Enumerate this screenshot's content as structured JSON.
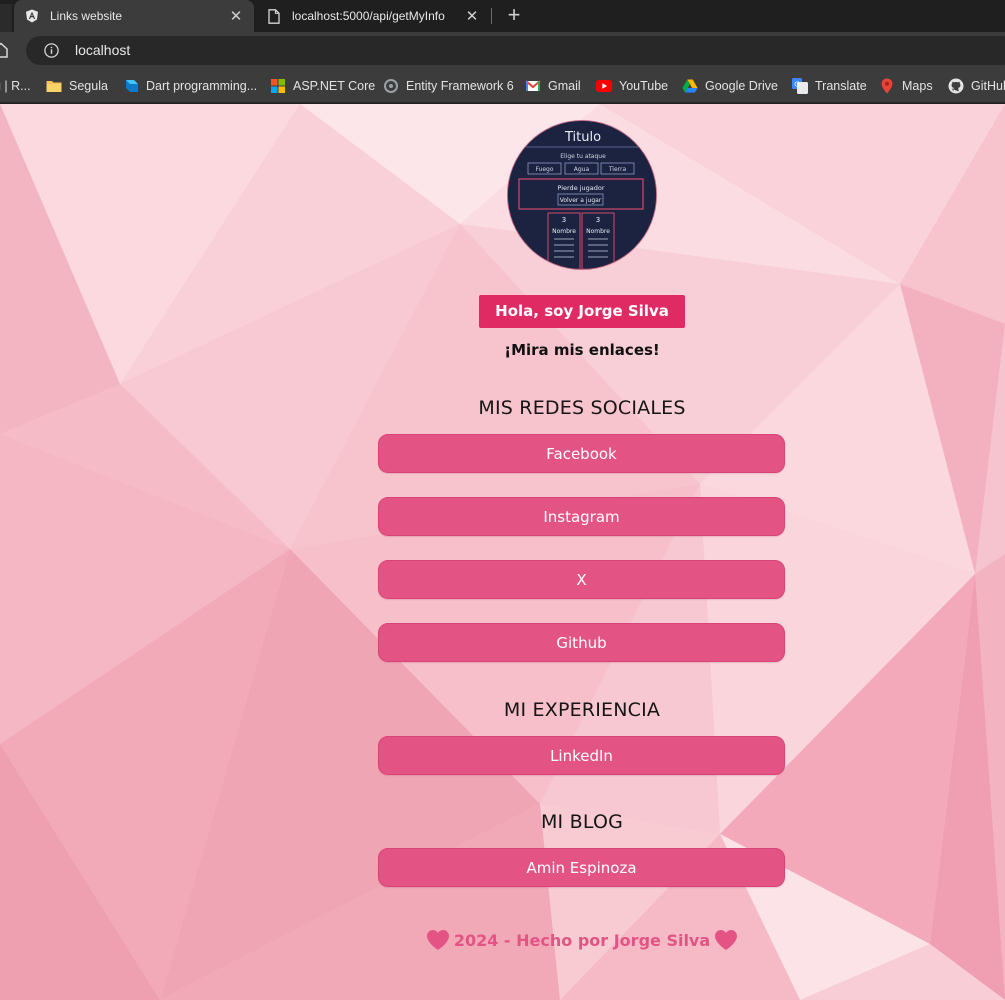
{
  "browser": {
    "tabs": [
      {
        "title": "Links website",
        "active": true,
        "icon": "angular-icon"
      },
      {
        "title": "localhost:5000/api/getMyInfo",
        "active": false,
        "icon": "document-icon"
      }
    ],
    "url": "localhost",
    "bookmarks": [
      {
        "label": "g | R...",
        "icon": "page-icon"
      },
      {
        "label": "Segula",
        "icon": "folder-icon"
      },
      {
        "label": "Dart programming...",
        "icon": "dart-icon"
      },
      {
        "label": "ASP.NET Core",
        "icon": "microsoft-icon"
      },
      {
        "label": "Entity Framework 6",
        "icon": "entity-framework-icon"
      },
      {
        "label": "Gmail",
        "icon": "gmail-icon"
      },
      {
        "label": "YouTube",
        "icon": "youtube-icon"
      },
      {
        "label": "Google Drive",
        "icon": "google-drive-icon"
      },
      {
        "label": "Translate",
        "icon": "translate-icon"
      },
      {
        "label": "Maps",
        "icon": "maps-icon"
      },
      {
        "label": "GitHub",
        "icon": "github-icon"
      }
    ]
  },
  "avatar": {
    "title": "Titulo",
    "subtitle": "Elige tu ataque",
    "buttons": [
      "Fuego",
      "Agua",
      "Tierra"
    ],
    "message": "Pierde jugador",
    "replay": "Volver a jugar",
    "scores": [
      "3",
      "3"
    ],
    "names": [
      "Nombre",
      "Nombre"
    ]
  },
  "profile": {
    "greeting": "Hola, soy Jorge Silva",
    "subtitle": "¡Mira mis enlaces!"
  },
  "sections": {
    "social": {
      "title": "MIS REDES SOCIALES",
      "links": [
        "Facebook",
        "Instagram",
        "X",
        "Github"
      ]
    },
    "experience": {
      "title": "MI EXPERIENCIA",
      "links": [
        "LinkedIn"
      ]
    },
    "blog": {
      "title": "MI BLOG",
      "links": [
        "Amin Espinoza"
      ]
    }
  },
  "footer": {
    "text": "2024 - Hecho por Jorge Silva"
  },
  "colors": {
    "accent": "#e35485",
    "greeting_bg": "#df2a63",
    "page_bg": "#f6c4ce"
  }
}
